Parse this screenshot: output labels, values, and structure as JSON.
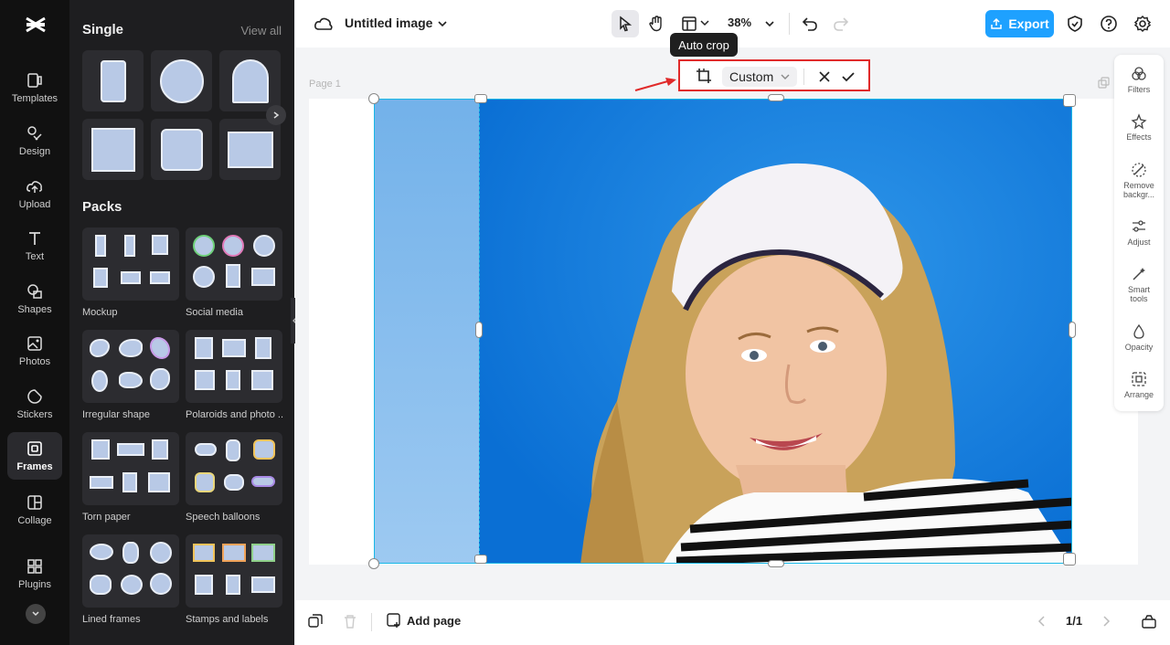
{
  "app": {
    "title": "Untitled image",
    "zoom": "38%",
    "export_label": "Export"
  },
  "tooltip": {
    "text": "Auto crop"
  },
  "crop": {
    "ratio": "Custom"
  },
  "rail": [
    {
      "label": "Templates"
    },
    {
      "label": "Design"
    },
    {
      "label": "Upload"
    },
    {
      "label": "Text"
    },
    {
      "label": "Shapes"
    },
    {
      "label": "Photos"
    },
    {
      "label": "Stickers"
    },
    {
      "label": "Frames"
    },
    {
      "label": "Collage"
    },
    {
      "label": "Plugins"
    }
  ],
  "panel": {
    "single_title": "Single",
    "view_all": "View all",
    "packs_title": "Packs",
    "packs": [
      {
        "label": "Mockup"
      },
      {
        "label": "Social media"
      },
      {
        "label": "Irregular shape"
      },
      {
        "label": "Polaroids and photo ..."
      },
      {
        "label": "Torn paper"
      },
      {
        "label": "Speech balloons"
      },
      {
        "label": "Lined frames"
      },
      {
        "label": "Stamps and labels"
      }
    ]
  },
  "canvas": {
    "page_label": "Page 1"
  },
  "props": [
    {
      "label": "Filters"
    },
    {
      "label": "Effects"
    },
    {
      "label": "Remove backgr..."
    },
    {
      "label": "Adjust"
    },
    {
      "label": "Smart tools"
    },
    {
      "label": "Opacity"
    },
    {
      "label": "Arrange"
    }
  ],
  "bottom": {
    "add_page": "Add page",
    "page_count": "1/1"
  },
  "colors": {
    "accent": "#1ea1ff",
    "selection": "#19b7e6",
    "highlight": "#e02a2a"
  }
}
